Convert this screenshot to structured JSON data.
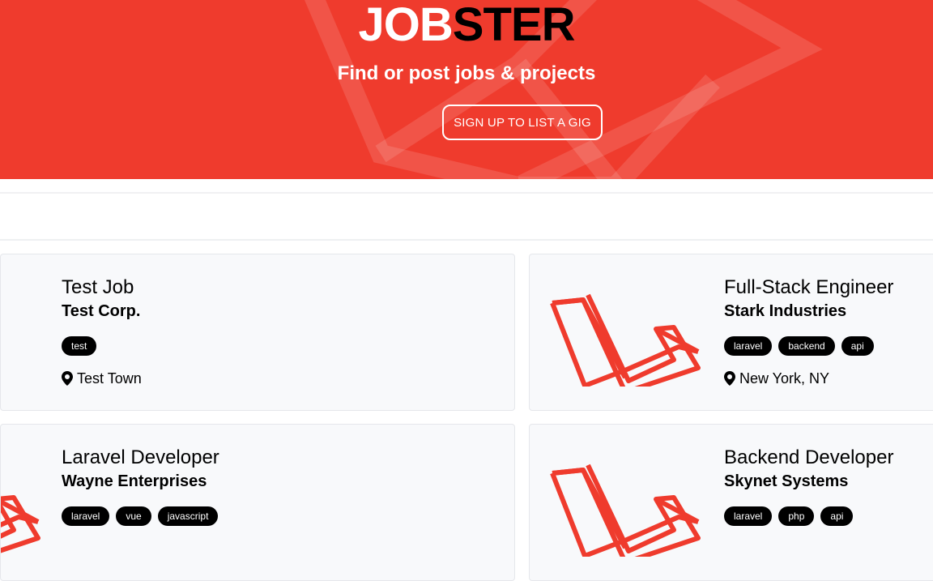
{
  "hero": {
    "brand_part1": "JOB",
    "brand_part2": "STER",
    "tagline": "Find or post jobs & projects",
    "cta_label": "SIGN UP TO LIST A GIG"
  },
  "colors": {
    "brand_red": "#ef3b2d",
    "tag_bg": "#000000",
    "card_bg": "#f8f9fb"
  },
  "listings": [
    {
      "title": "Test Job",
      "company": "Test Corp.",
      "tags": [
        "test"
      ],
      "location": "Test Town",
      "logo": "none"
    },
    {
      "title": "Full-Stack Engineer",
      "company": "Stark Industries",
      "tags": [
        "laravel",
        "backend",
        "api"
      ],
      "location": "New York, NY",
      "logo": "laravel-logo-icon"
    },
    {
      "title": "Laravel Developer",
      "company": "Wayne Enterprises",
      "tags": [
        "laravel",
        "vue",
        "javascript"
      ],
      "location": "",
      "logo": "laravel-logo-icon"
    },
    {
      "title": "Backend Developer",
      "company": "Skynet Systems",
      "tags": [
        "laravel",
        "php",
        "api"
      ],
      "location": "",
      "logo": "laravel-logo-icon"
    }
  ]
}
